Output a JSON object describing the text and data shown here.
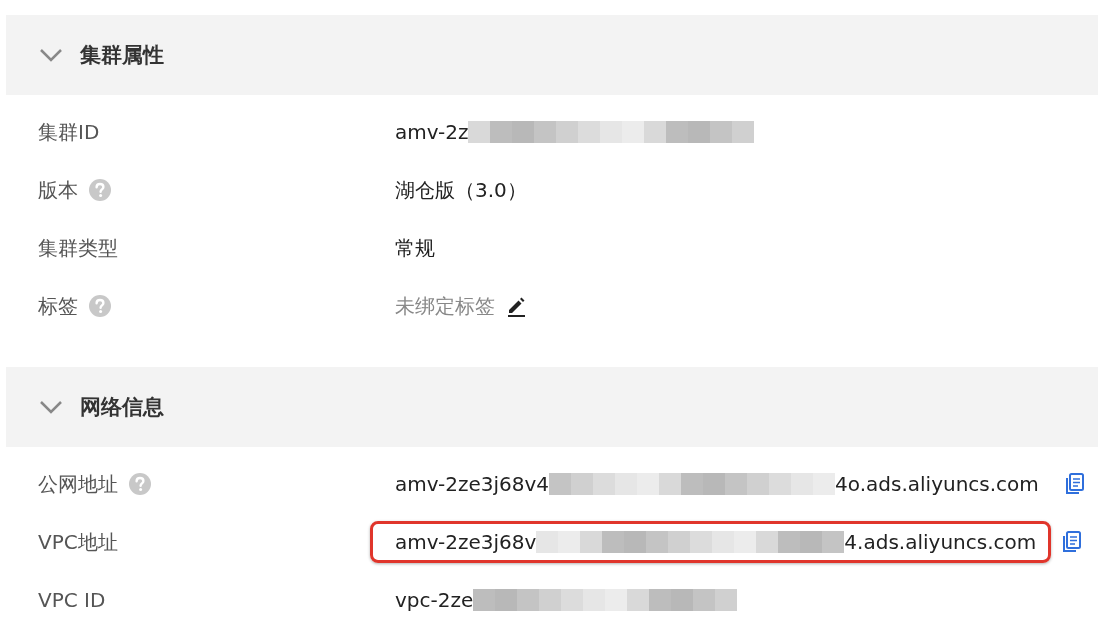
{
  "sections": [
    {
      "title": "集群属性",
      "expanded": true,
      "rows": [
        {
          "label": "集群ID",
          "help": false,
          "value_prefix": "amv-2z",
          "masked": true,
          "value_suffix": "",
          "muted": false,
          "editable": false,
          "copyable": false,
          "highlighted": false
        },
        {
          "label": "版本",
          "help": true,
          "value_prefix": "湖仓版（3.0）",
          "masked": false,
          "value_suffix": "",
          "muted": false,
          "editable": false,
          "copyable": false,
          "highlighted": false
        },
        {
          "label": "集群类型",
          "help": false,
          "value_prefix": "常规",
          "masked": false,
          "value_suffix": "",
          "muted": false,
          "editable": false,
          "copyable": false,
          "highlighted": false
        },
        {
          "label": "标签",
          "help": true,
          "value_prefix": "未绑定标签",
          "masked": false,
          "value_suffix": "",
          "muted": true,
          "editable": true,
          "copyable": false,
          "highlighted": false
        }
      ]
    },
    {
      "title": "网络信息",
      "expanded": true,
      "rows": [
        {
          "label": "公网地址",
          "help": true,
          "value_prefix": "amv-2ze3j68v4",
          "masked": true,
          "value_suffix": "4o.ads.aliyuncs.com",
          "muted": false,
          "editable": false,
          "copyable": true,
          "highlighted": false
        },
        {
          "label": "VPC地址",
          "help": false,
          "value_prefix": "amv-2ze3j68v",
          "masked": true,
          "value_suffix": "4.ads.aliyuncs.com",
          "muted": false,
          "editable": false,
          "copyable": true,
          "highlighted": true
        },
        {
          "label": "VPC ID",
          "help": false,
          "value_prefix": "vpc-2ze",
          "masked": true,
          "value_suffix": "",
          "muted": false,
          "editable": false,
          "copyable": false,
          "highlighted": false
        }
      ]
    }
  ]
}
